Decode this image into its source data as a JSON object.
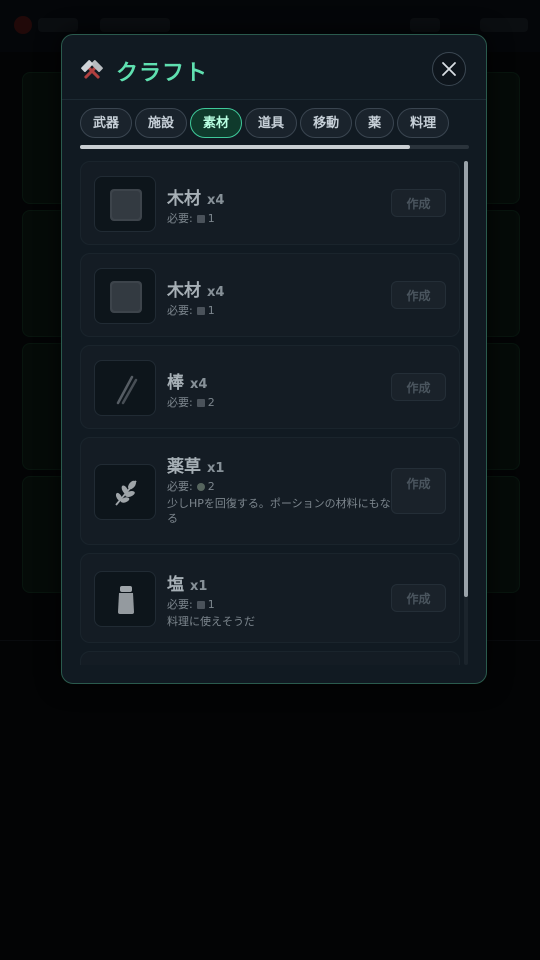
{
  "modal": {
    "title": "クラフト",
    "title_icon": "crossed-hammers-icon",
    "close_icon": "close-icon"
  },
  "tabs": [
    {
      "label": "武器",
      "active": false
    },
    {
      "label": "施設",
      "active": false
    },
    {
      "label": "素材",
      "active": true
    },
    {
      "label": "道具",
      "active": false
    },
    {
      "label": "移動",
      "active": false
    },
    {
      "label": "薬",
      "active": false
    },
    {
      "label": "料理",
      "active": false
    }
  ],
  "items": [
    {
      "name": "木材",
      "qty": "x4",
      "req_label": "必要:",
      "req_icon": "material-icon",
      "req_count": "1",
      "desc": "",
      "button": "作成",
      "icon": "wood-block-icon"
    },
    {
      "name": "木材",
      "qty": "x4",
      "req_label": "必要:",
      "req_icon": "material-icon",
      "req_count": "1",
      "desc": "",
      "button": "作成",
      "icon": "wood-block-icon"
    },
    {
      "name": "棒",
      "qty": "x4",
      "req_label": "必要:",
      "req_icon": "wood-icon",
      "req_count": "2",
      "desc": "",
      "button": "作成",
      "icon": "sticks-icon"
    },
    {
      "name": "薬草",
      "qty": "x1",
      "req_label": "必要:",
      "req_icon": "leaf-icon",
      "req_count": "2",
      "desc": "少しHPを回復する。ポーションの材料にもなる",
      "button": "作成",
      "icon": "herb-icon"
    },
    {
      "name": "塩",
      "qty": "x1",
      "req_label": "必要:",
      "req_icon": "material-icon",
      "req_count": "1",
      "desc": "料理に使えそうだ",
      "button": "作成",
      "icon": "salt-shaker-icon"
    }
  ],
  "colors": {
    "accent": "#5fe0b0",
    "modal_border": "#2a5a4d",
    "active_tab_bg": "#0f3a2c"
  }
}
